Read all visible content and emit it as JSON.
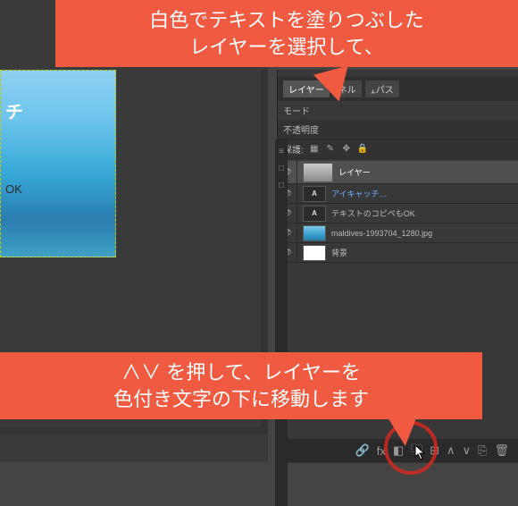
{
  "annotations": {
    "note1_line1": "白色でテキストを塗りつぶした",
    "note1_line2": "レイヤーを選択して、",
    "note2_line1": "∧∨ を押して、レイヤーを",
    "note2_line2": "色付き文字の下に移動します"
  },
  "canvas": {
    "text1": "チ",
    "text2": "OK"
  },
  "panels": {
    "tabs": {
      "layers": "レイヤー",
      "channels": "ネル",
      "paths": "パス"
    },
    "mode_label": "モード",
    "opacity_label": "不透明度",
    "lock_label": "保護:"
  },
  "layers": [
    {
      "name": "レイヤー",
      "selected": true,
      "type": "sel"
    },
    {
      "name": "アイキャッチ…",
      "selected": false,
      "type": "txt"
    },
    {
      "name": "テキストのコピペもOK",
      "selected": false,
      "type": "txt"
    },
    {
      "name": "maldives-1993704_1280.jpg",
      "selected": false,
      "type": "img"
    },
    {
      "name": "背景",
      "selected": false,
      "type": "white"
    }
  ],
  "footer_icons": {
    "link": "🔗",
    "fx": "fx",
    "mask": "◧",
    "folder": "🗀",
    "new": "⊞",
    "up": "∧",
    "down": "∨",
    "copy": "⎘",
    "delete": "🗑"
  }
}
